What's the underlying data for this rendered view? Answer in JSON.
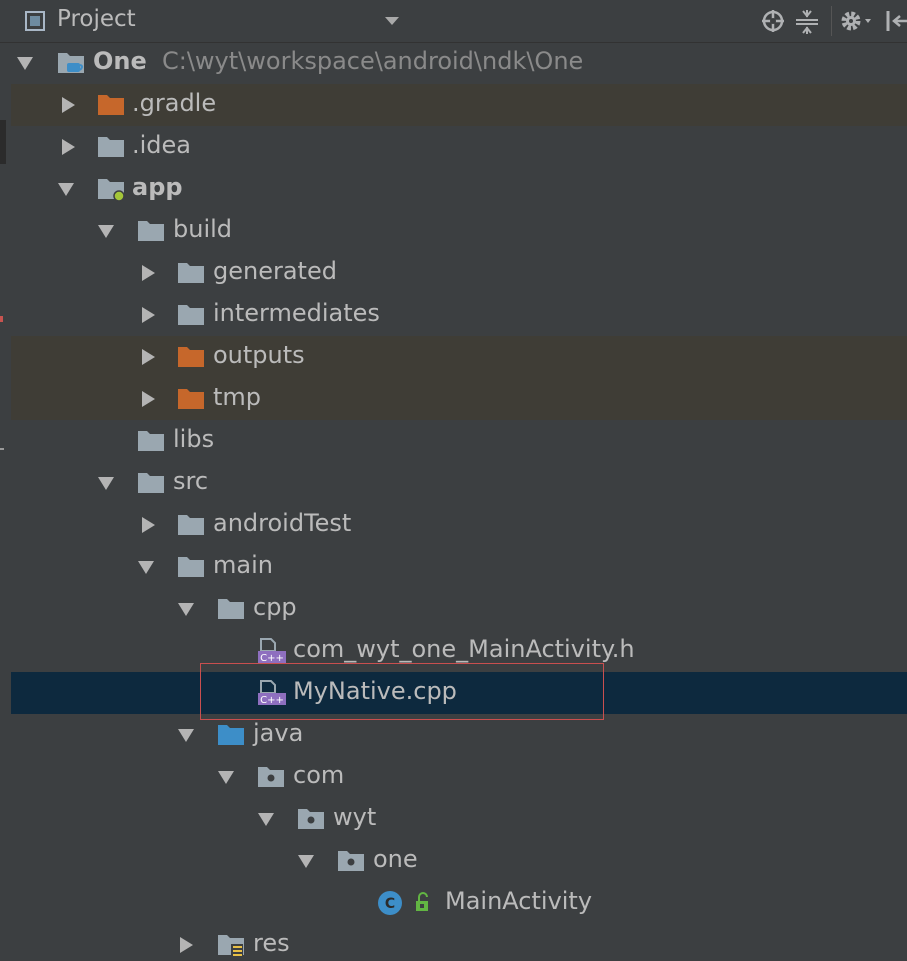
{
  "header": {
    "title": "Project",
    "icons": [
      "project-view-icon",
      "dropdown-arrow-icon",
      "scroll-from-source-icon",
      "collapse-all-icon",
      "settings-gear-icon",
      "hide-panel-icon"
    ]
  },
  "tree": {
    "root": {
      "label": "One",
      "path": "C:\\wyt\\workspace\\android\\ndk\\One"
    },
    "items": [
      {
        "label": ".gradle"
      },
      {
        "label": ".idea"
      },
      {
        "label": "app"
      },
      {
        "label": "build"
      },
      {
        "label": "generated"
      },
      {
        "label": "intermediates"
      },
      {
        "label": "outputs"
      },
      {
        "label": "tmp"
      },
      {
        "label": "libs"
      },
      {
        "label": "src"
      },
      {
        "label": "androidTest"
      },
      {
        "label": "main"
      },
      {
        "label": "cpp"
      },
      {
        "label": "com_wyt_one_MainActivity.h"
      },
      {
        "label": "MyNative.cpp"
      },
      {
        "label": "java"
      },
      {
        "label": "com"
      },
      {
        "label": "wyt"
      },
      {
        "label": "one"
      },
      {
        "label": "MainActivity"
      },
      {
        "label": "res"
      }
    ]
  },
  "colors": {
    "background": "#3c3f41",
    "selection": "#0d293e",
    "excluded_row": "#3f3d36",
    "folder_gray": "#9aa7b0",
    "folder_orange": "#c6672b",
    "folder_blue": "#3d8ec8",
    "highlight_border": "#c94f4f"
  }
}
